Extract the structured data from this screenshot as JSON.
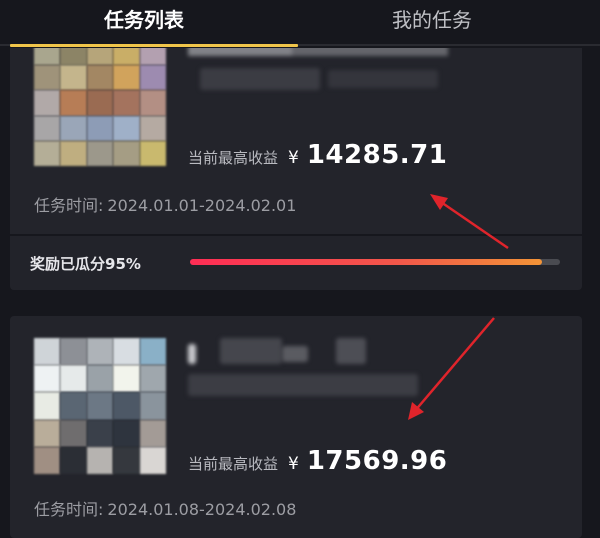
{
  "tabs": {
    "active": "任务列表",
    "inactive": "我的任务"
  },
  "cards": [
    {
      "reward_label": "当前最高收益",
      "currency": "¥",
      "amount": "14285.71",
      "period_label": "任务时间:",
      "period_value": "2024.01.01-2024.02.01",
      "progress_text": "奖励已瓜分95%",
      "progress_value": 0.95
    },
    {
      "reward_label": "当前最高收益",
      "currency": "¥",
      "amount": "17569.96",
      "period_label": "任务时间:",
      "period_value": "2024.01.08-2024.02.08"
    }
  ],
  "colors": {
    "background": "#16171d",
    "card": "#23242b",
    "tab_indicator": "#f0c54a",
    "progress_start": "#ff2d55",
    "progress_end": "#f39437",
    "annotation_arrow": "#e0242b"
  }
}
